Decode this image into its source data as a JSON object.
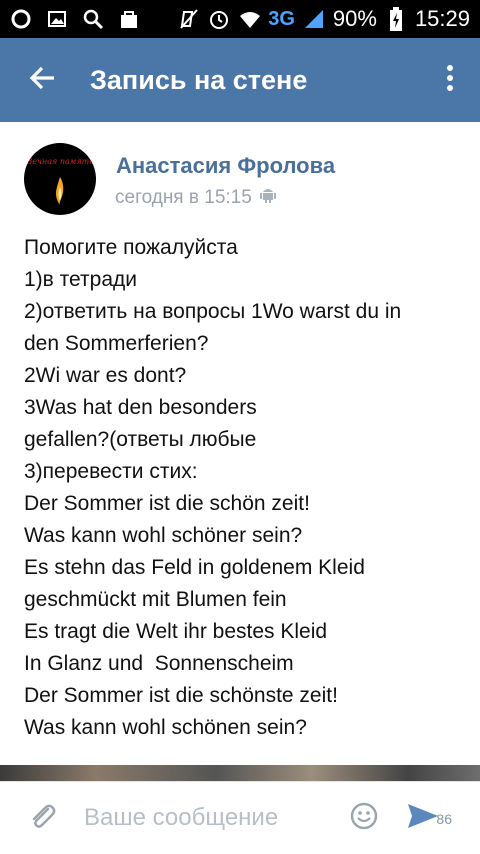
{
  "statusbar": {
    "network": "3G",
    "battery": "90%",
    "time": "15:29",
    "icons": [
      "circle-icon",
      "image-icon",
      "search-icon",
      "bag-icon",
      "mute-icon",
      "alarm-icon",
      "wifi-icon",
      "signal-icon",
      "battery-icon"
    ]
  },
  "appbar": {
    "title": "Запись на стене",
    "back_icon": "arrow-left-icon",
    "menu_icon": "more-vert-icon",
    "color": "#4a76a8"
  },
  "post": {
    "author": "Анастасия Фролова",
    "time": "сегодня в 15:15",
    "device_icon": "android-icon",
    "avatar_text": "Вечная память",
    "lines": [
      "Помогите пожалуйста",
      "1)в тетради",
      "2)ответить на вопросы 1Wo warst du in",
      "den Sommerferien?",
      "2Wi war es dont?",
      "3Was hat den besonders",
      "gefallen?(ответы любые",
      "3)перевести стих:",
      "Der Sommer ist die schön zeit!",
      "Was kann wohl schöner sein?",
      "Es stehn das Feld in goldenem Kleid",
      "geschmückt mit Blumen fein",
      "Es tragt die Welt ihr bestes Kleid",
      "In Glanz und  Sonnenscheim",
      "Der Sommer ist die schönste zeit!",
      "Was kann wohl schönen sein?"
    ]
  },
  "composer": {
    "placeholder": "Ваше сообщение",
    "badge": "86",
    "attach_icon": "paperclip-icon",
    "emoji_icon": "smiley-icon",
    "send_icon": "send-icon"
  }
}
